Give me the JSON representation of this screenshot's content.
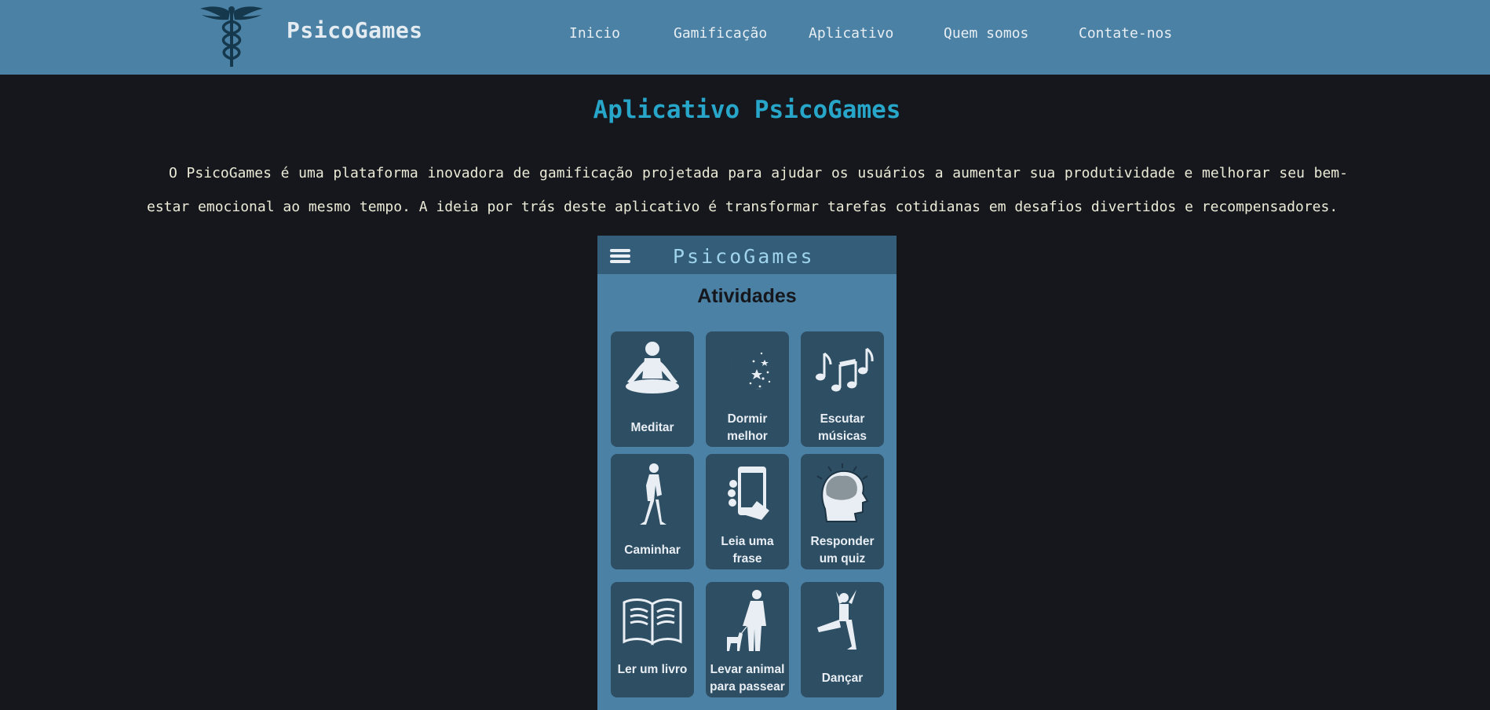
{
  "header": {
    "brand": "PsicoGames",
    "logo_icon": "caduceus-icon",
    "nav": [
      "Inicio",
      "Gamificação",
      "Aplicativo",
      "Quem somos",
      "Contate-nos"
    ]
  },
  "main": {
    "title": "Aplicativo PsicoGames",
    "intro": "O PsicoGames é uma plataforma inovadora de gamificação projetada para ajudar os usuários a aumentar sua produtividade e melhorar seu bem-estar emocional ao mesmo tempo. A ideia por trás deste aplicativo é transformar tarefas cotidianas em desafios divertidos e recompensadores."
  },
  "app": {
    "brand": "PsicoGames",
    "menu_icon": "hamburger-menu-icon",
    "section_title": "Atividades",
    "activities": [
      {
        "label": "Meditar",
        "icon": "meditation-icon"
      },
      {
        "label": "Dormir melhor",
        "icon": "moon-stars-icon"
      },
      {
        "label": "Escutar músicas",
        "icon": "music-notes-icon"
      },
      {
        "label": "Caminhar",
        "icon": "walking-person-icon"
      },
      {
        "label": "Leia uma frase",
        "icon": "phone-hand-icon"
      },
      {
        "label": "Responder um quiz",
        "icon": "head-brain-icon"
      },
      {
        "label": "Ler um livro",
        "icon": "open-book-icon"
      },
      {
        "label": "Levar animal para passear",
        "icon": "dog-walk-icon"
      },
      {
        "label": "Dançar",
        "icon": "dancer-icon"
      }
    ]
  },
  "colors": {
    "header_bg": "#4a81a4",
    "page_bg": "#15171c",
    "title": "#27a6c9",
    "tile_bg": "#2e4e63",
    "app_bar": "#335d78"
  }
}
